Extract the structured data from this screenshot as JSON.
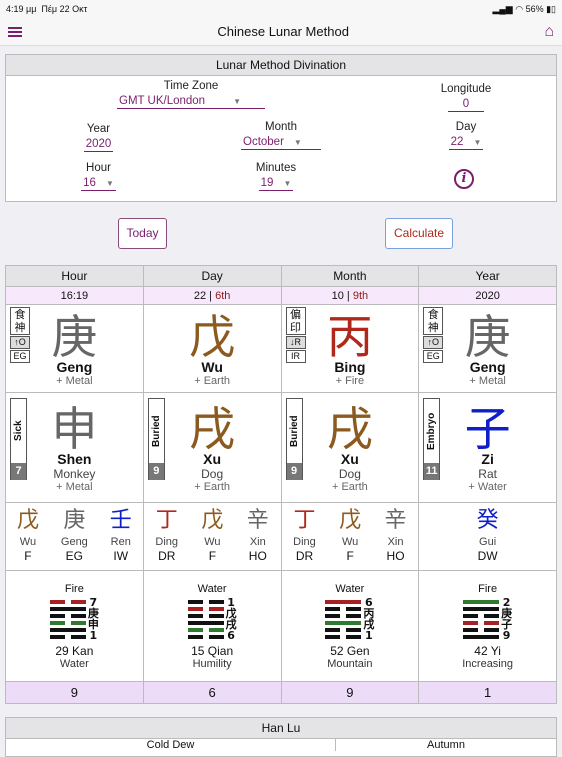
{
  "status": {
    "time": "4:19 μμ",
    "date": "Πέμ 22 Οκτ",
    "battery": "56%"
  },
  "nav": {
    "title": "Chinese Lunar Method"
  },
  "form": {
    "title": "Lunar Method Divination",
    "timezone_label": "Time Zone",
    "timezone": "GMT UK/London",
    "longitude_label": "Longitude",
    "longitude": "0",
    "year_label": "Year",
    "year": "2020",
    "month_label": "Month",
    "month": "October",
    "day_label": "Day",
    "day": "22",
    "hour_label": "Hour",
    "hour": "16",
    "minutes_label": "Minutes",
    "minutes": "19",
    "info": "i"
  },
  "buttons": {
    "today": "Today",
    "calculate": "Calculate"
  },
  "colors": {
    "accent": "#7a1f6e",
    "metal": "#666666",
    "earth": "#8b5a1e",
    "fire": "#b0281c",
    "water": "#1020c8"
  },
  "pillars": [
    {
      "header": "Hour",
      "date": "16:19",
      "date_sub": "",
      "stem": {
        "char": "庚",
        "pinyin": "Geng",
        "element": "+ Metal",
        "color": "#666666",
        "tag": [
          "食",
          "神",
          "↑O",
          "EG"
        ]
      },
      "branch": {
        "char": "申",
        "pinyin": "Shen",
        "animal": "Monkey",
        "element": "+ Metal",
        "color": "#666666",
        "stage": "Sick",
        "num": "7"
      },
      "hidden": [
        {
          "char": "戊",
          "name": "Wu",
          "god": "F",
          "color": "#8b5a1e"
        },
        {
          "char": "庚",
          "name": "Geng",
          "god": "EG",
          "color": "#666666"
        },
        {
          "char": "壬",
          "name": "Ren",
          "god": "IW",
          "color": "#1020c8"
        }
      ],
      "hex": {
        "element": "Fire",
        "lines": [
          [
            "b",
            "r"
          ],
          [
            "s",
            "k"
          ],
          [
            "b",
            "k"
          ],
          [
            "b",
            "g"
          ],
          [
            "s",
            "k"
          ],
          [
            "b",
            "k"
          ]
        ],
        "labels": [
          "7",
          "庚",
          "申",
          "1"
        ],
        "name": "29 Kan",
        "meaning": "Water"
      },
      "number": "9"
    },
    {
      "header": "Day",
      "date": "22 | ",
      "date_sub": "6th",
      "stem": {
        "char": "戊",
        "pinyin": "Wu",
        "element": "+ Earth",
        "color": "#8b5a1e",
        "tag": null
      },
      "branch": {
        "char": "戌",
        "pinyin": "Xu",
        "animal": "Dog",
        "element": "+ Earth",
        "color": "#8b5a1e",
        "stage": "Buried",
        "num": "9"
      },
      "hidden": [
        {
          "char": "丁",
          "name": "Ding",
          "god": "DR",
          "color": "#b0281c"
        },
        {
          "char": "戊",
          "name": "Wu",
          "god": "F",
          "color": "#8b5a1e"
        },
        {
          "char": "辛",
          "name": "Xin",
          "god": "HO",
          "color": "#666666"
        }
      ],
      "hex": {
        "element": "Water",
        "lines": [
          [
            "b",
            "k"
          ],
          [
            "b",
            "r"
          ],
          [
            "b",
            "k"
          ],
          [
            "s",
            "k"
          ],
          [
            "b",
            "g"
          ],
          [
            "b",
            "k"
          ]
        ],
        "labels": [
          "1",
          "戊",
          "戌",
          "6"
        ],
        "name": "15 Qian",
        "meaning": "Humility"
      },
      "number": "6"
    },
    {
      "header": "Month",
      "date": "10 | ",
      "date_sub": "9th",
      "stem": {
        "char": "丙",
        "pinyin": "Bing",
        "element": "+ Fire",
        "color": "#b0281c",
        "tag": [
          "偏",
          "印",
          "↓R",
          "IR"
        ]
      },
      "branch": {
        "char": "戌",
        "pinyin": "Xu",
        "animal": "Dog",
        "element": "+ Earth",
        "color": "#8b5a1e",
        "stage": "Buried",
        "num": "9"
      },
      "hidden": [
        {
          "char": "丁",
          "name": "Ding",
          "god": "DR",
          "color": "#b0281c"
        },
        {
          "char": "戊",
          "name": "Wu",
          "god": "F",
          "color": "#8b5a1e"
        },
        {
          "char": "辛",
          "name": "Xin",
          "god": "HO",
          "color": "#666666"
        }
      ],
      "hex": {
        "element": "Water",
        "lines": [
          [
            "s",
            "r"
          ],
          [
            "b",
            "k"
          ],
          [
            "b",
            "k"
          ],
          [
            "s",
            "g"
          ],
          [
            "b",
            "k"
          ],
          [
            "b",
            "k"
          ]
        ],
        "labels": [
          "6",
          "丙",
          "戌",
          "1"
        ],
        "name": "52 Gen",
        "meaning": "Mountain"
      },
      "number": "9"
    },
    {
      "header": "Year",
      "date": "2020",
      "date_sub": "",
      "stem": {
        "char": "庚",
        "pinyin": "Geng",
        "element": "+ Metal",
        "color": "#666666",
        "tag": [
          "食",
          "神",
          "↑O",
          "EG"
        ]
      },
      "branch": {
        "char": "子",
        "pinyin": "Zi",
        "animal": "Rat",
        "element": "+ Water",
        "color": "#1020c8",
        "stage": "Embryo",
        "num": "11"
      },
      "hidden": [
        {
          "char": "癸",
          "name": "Gui",
          "god": "DW",
          "color": "#1020c8"
        }
      ],
      "hex": {
        "element": "Fire",
        "lines": [
          [
            "s",
            "g"
          ],
          [
            "s",
            "k"
          ],
          [
            "b",
            "k"
          ],
          [
            "b",
            "r"
          ],
          [
            "b",
            "k"
          ],
          [
            "s",
            "k"
          ]
        ],
        "labels": [
          "2",
          "庚",
          "子",
          "9"
        ],
        "name": "42 Yi",
        "meaning": "Increasing"
      },
      "number": "1"
    }
  ],
  "hanlu": {
    "title": "Han Lu",
    "left": "Cold Dew",
    "right": "Autumn"
  }
}
